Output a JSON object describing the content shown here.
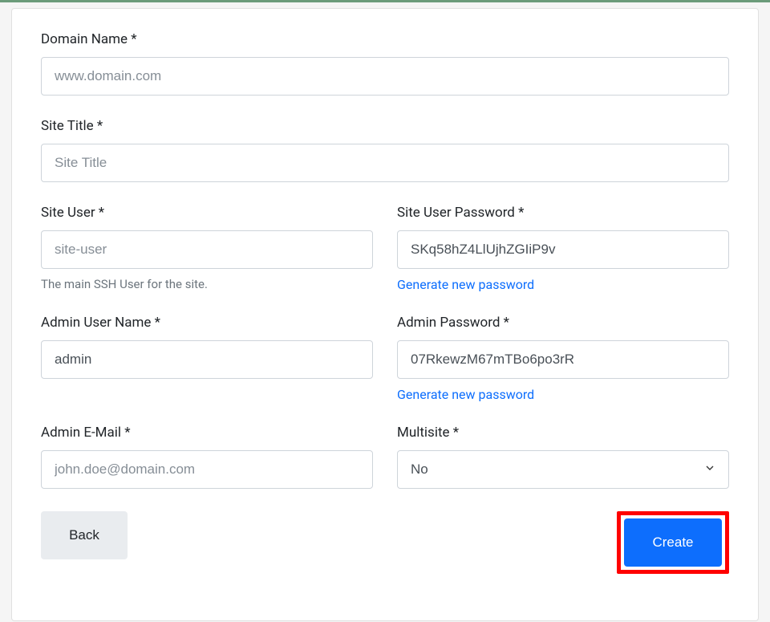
{
  "fields": {
    "domain": {
      "label": "Domain Name *",
      "placeholder": "www.domain.com",
      "value": ""
    },
    "site_title": {
      "label": "Site Title *",
      "placeholder": "Site Title",
      "value": ""
    },
    "site_user": {
      "label": "Site User *",
      "placeholder": "site-user",
      "value": "",
      "help": "The main SSH User for the site."
    },
    "site_user_password": {
      "label": "Site User Password *",
      "value": "SKq58hZ4LlUjhZGIiP9v",
      "generate_link": "Generate new password"
    },
    "admin_user": {
      "label": "Admin User Name *",
      "value": "admin"
    },
    "admin_password": {
      "label": "Admin Password *",
      "value": "07RkewzM67mTBo6po3rR",
      "generate_link": "Generate new password"
    },
    "admin_email": {
      "label": "Admin E-Mail *",
      "placeholder": "john.doe@domain.com",
      "value": ""
    },
    "multisite": {
      "label": "Multisite *",
      "value": "No"
    }
  },
  "buttons": {
    "back": "Back",
    "create": "Create"
  }
}
